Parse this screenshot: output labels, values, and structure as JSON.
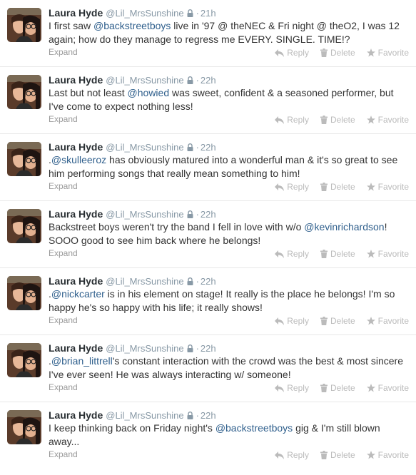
{
  "icons": {
    "lock": "lock-icon",
    "reply": "reply-icon",
    "delete": "trash-icon",
    "favorite": "star-icon",
    "avatar": "avatar-photo"
  },
  "colors": {
    "username": "#8899a6",
    "mention": "#2f5f8c",
    "action": "#bbbbbb"
  },
  "tweets": [
    {
      "fullname": "Laura Hyde",
      "username": "@Lil_MrsSunshine",
      "sep": "·",
      "time": "21h",
      "parts": [
        "I first saw ",
        "@backstreetboys",
        " live in '97 @ theNEC & Fri night @ theO2, I was 12 again; how do they manage to regress me EVERY. SINGLE. TIME!?"
      ],
      "expand": "Expand",
      "reply": "Reply",
      "delete": "Delete",
      "favorite": "Favorite"
    },
    {
      "fullname": "Laura Hyde",
      "username": "@Lil_MrsSunshine",
      "sep": "·",
      "time": "22h",
      "parts": [
        "Last but not least ",
        "@howied",
        " was sweet, confident & a seasoned performer, but I've come to expect nothing less!"
      ],
      "expand": "Expand",
      "reply": "Reply",
      "delete": "Delete",
      "favorite": "Favorite"
    },
    {
      "fullname": "Laura Hyde",
      "username": "@Lil_MrsSunshine",
      "sep": "·",
      "time": "22h",
      "parts": [
        ".",
        "@skulleeroz",
        " has obviously matured into a wonderful man & it's so great to see him performing songs that really mean something to him!"
      ],
      "expand": "Expand",
      "reply": "Reply",
      "delete": "Delete",
      "favorite": "Favorite"
    },
    {
      "fullname": "Laura Hyde",
      "username": "@Lil_MrsSunshine",
      "sep": "·",
      "time": "22h",
      "parts": [
        "Backstreet boys weren't try the band I fell in love with w/o ",
        "@kevinrichardson",
        "! SOOO good to see him back where he belongs!"
      ],
      "expand": "Expand",
      "reply": "Reply",
      "delete": "Delete",
      "favorite": "Favorite"
    },
    {
      "fullname": "Laura Hyde",
      "username": "@Lil_MrsSunshine",
      "sep": "·",
      "time": "22h",
      "parts": [
        ".",
        "@nickcarter",
        " is in his element on stage! It really is the place he belongs! I'm so happy he's so happy with his life; it really shows!"
      ],
      "expand": "Expand",
      "reply": "Reply",
      "delete": "Delete",
      "favorite": "Favorite"
    },
    {
      "fullname": "Laura Hyde",
      "username": "@Lil_MrsSunshine",
      "sep": "·",
      "time": "22h",
      "parts": [
        ".",
        "@brian_littrell",
        "'s constant interaction with the crowd was the best & most sincere I've ever seen! He was always interacting w/ someone!"
      ],
      "expand": "Expand",
      "reply": "Reply",
      "delete": "Delete",
      "favorite": "Favorite"
    },
    {
      "fullname": "Laura Hyde",
      "username": "@Lil_MrsSunshine",
      "sep": "·",
      "time": "22h",
      "parts": [
        "I keep thinking back on Friday night's ",
        "@backstreetboys",
        " gig & I'm still blown away..."
      ],
      "expand": "Expand",
      "reply": "Reply",
      "delete": "Delete",
      "favorite": "Favorite"
    }
  ]
}
